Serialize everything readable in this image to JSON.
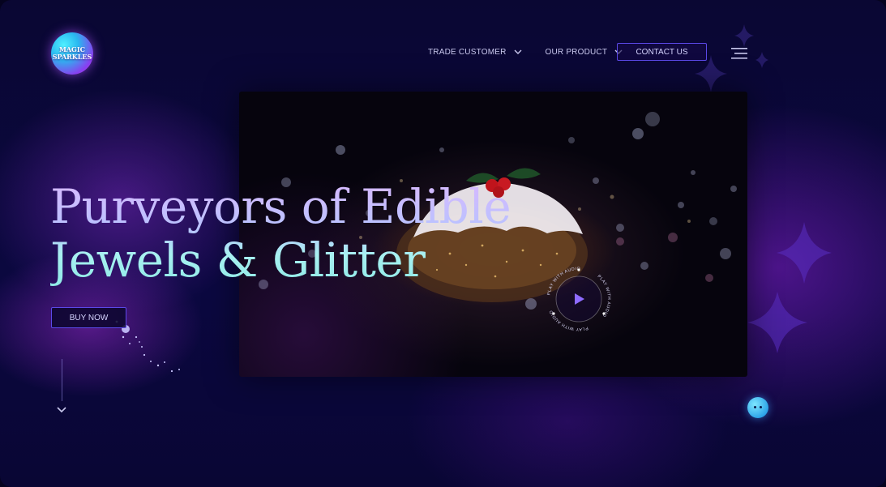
{
  "logo": {
    "line1": "MAGIC",
    "line2": "SPARKLES"
  },
  "nav": {
    "items": [
      {
        "label": "TRADE CUSTOMER",
        "icon": "chevron-down-icon"
      },
      {
        "label": "OUR PRODUCT",
        "icon": "chevron-down-icon"
      }
    ],
    "contact_label": "CONTACT US",
    "menu_icon": "hamburger-menu-icon"
  },
  "hero": {
    "headline_line1": "Purveyors of Edible",
    "headline_line2": "Jewels & Glitter",
    "buy_label": "BUY NOW",
    "play_caption": "PLAY WITH AUDIO",
    "scroll_icon": "chevron-down-icon"
  },
  "colors": {
    "background": "#0a0733",
    "accent_border": "#5b49e8",
    "headline_top": "#d8b8ff",
    "headline_bottom": "#8fe9e6",
    "glow_purple": "#8a2be2"
  }
}
